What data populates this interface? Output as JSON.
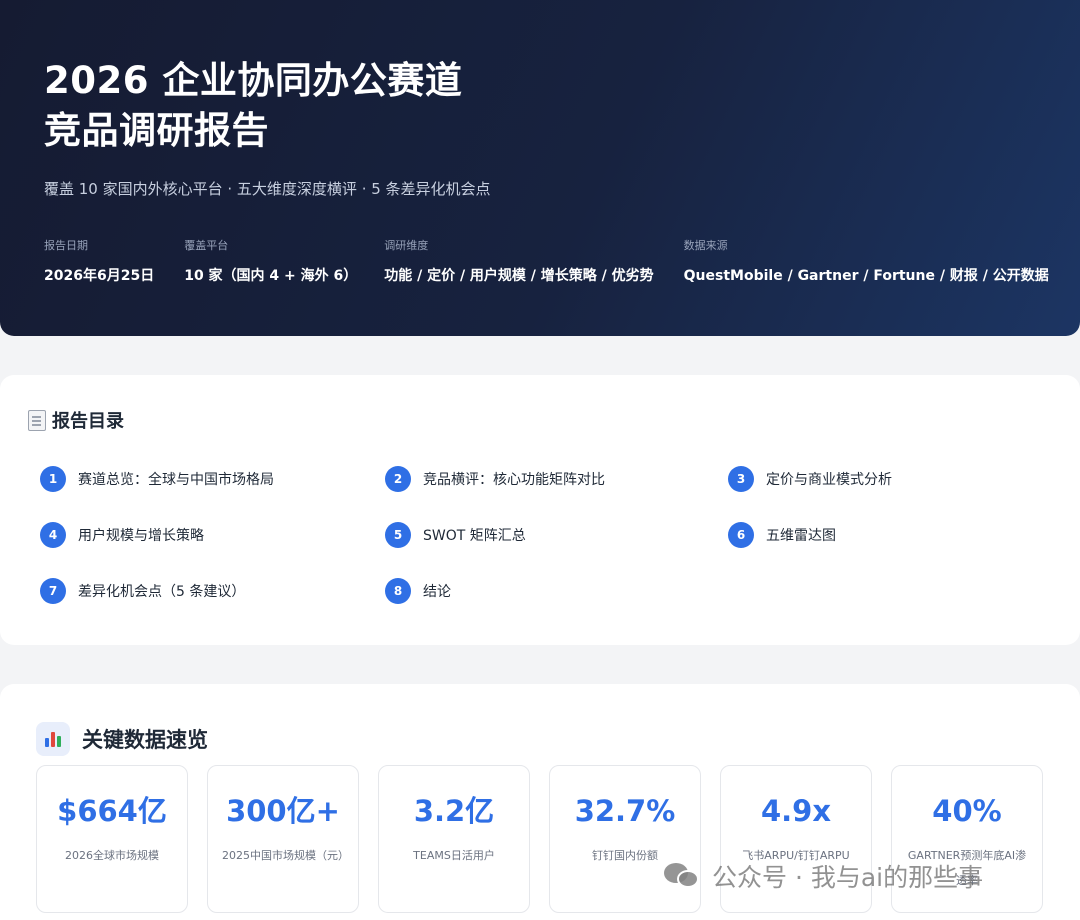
{
  "hero": {
    "title_line1": "2026 企业协同办公赛道",
    "title_line2": "竞品调研报告",
    "subtitle": "覆盖 10 家国内外核心平台 · 五大维度深度横评 · 5 条差异化机会点",
    "meta": [
      {
        "label": "报告日期",
        "value": "2026年6月25日"
      },
      {
        "label": "覆盖平台",
        "value": "10 家（国内 4 + 海外 6）"
      },
      {
        "label": "调研维度",
        "value": "功能 / 定价 / 用户规模 / 增长策略 / 优劣势"
      },
      {
        "label": "数据来源",
        "value": "QuestMobile / Gartner / Fortune / 财报 / 公开数据"
      }
    ]
  },
  "toc": {
    "title": "报告目录",
    "icon": "document-icon",
    "items": [
      {
        "num": "1",
        "label": "赛道总览：全球与中国市场格局"
      },
      {
        "num": "2",
        "label": "竞品横评：核心功能矩阵对比"
      },
      {
        "num": "3",
        "label": "定价与商业模式分析"
      },
      {
        "num": "4",
        "label": "用户规模与增长策略"
      },
      {
        "num": "5",
        "label": "SWOT 矩阵汇总"
      },
      {
        "num": "6",
        "label": "五维雷达图"
      },
      {
        "num": "7",
        "label": "差异化机会点（5 条建议）"
      },
      {
        "num": "8",
        "label": "结论"
      }
    ]
  },
  "key_data": {
    "title": "关键数据速览",
    "icon": "bar-chart-icon",
    "stats": [
      {
        "value": "$664亿",
        "label": "2026全球市场规模"
      },
      {
        "value": "300亿+",
        "label": "2025中国市场规模（元）"
      },
      {
        "value": "3.2亿",
        "label": "TEAMS日活用户"
      },
      {
        "value": "32.7%",
        "label": "钉钉国内份额"
      },
      {
        "value": "4.9x",
        "label": "飞书ARPU/钉钉ARPU"
      },
      {
        "value": "40%",
        "label": "GARTNER预测年底AI渗透率"
      }
    ]
  },
  "watermark": {
    "text": "公众号 · 我与ai的那些事",
    "icon": "wechat-icon"
  },
  "colors": {
    "accent": "#2f6fe5",
    "hero_bg_start": "#151b32",
    "hero_bg_end": "#1c3563"
  }
}
